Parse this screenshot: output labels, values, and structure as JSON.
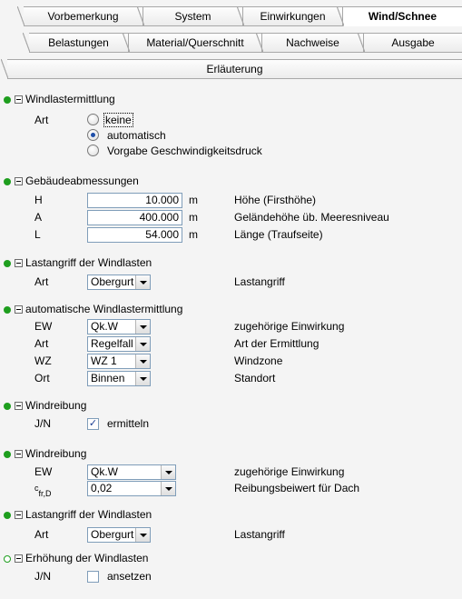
{
  "tabs": {
    "row1": [
      "Vorbemerkung",
      "System",
      "Einwirkungen",
      "Wind/Schnee"
    ],
    "row1_active_index": 3,
    "row2": [
      "Belastungen",
      "Material/Querschnitt",
      "Nachweise",
      "Ausgabe"
    ],
    "row3": [
      "Erläuterung"
    ]
  },
  "colors": {
    "status_green": "#1e9e1e",
    "field_border": "#7f9db9",
    "radio_selected": "#1f4fa8"
  },
  "sections": {
    "windlastermittlung": {
      "title": "Windlastermittlung",
      "art_label": "Art",
      "options": [
        "keine",
        "automatisch",
        "Vorgabe Geschwindigkeitsdruck"
      ],
      "selected": "automatisch"
    },
    "gebaeude": {
      "title": "Gebäudeabmessungen",
      "rows": [
        {
          "label": "H",
          "value": "10.000",
          "unit": "m",
          "desc": "Höhe (Firsthöhe)"
        },
        {
          "label": "A",
          "value": "400.000",
          "unit": "m",
          "desc": "Geländehöhe üb. Meeresniveau"
        },
        {
          "label": "L",
          "value": "54.000",
          "unit": "m",
          "desc": "Länge (Traufseite)"
        }
      ]
    },
    "lastangriff1": {
      "title": "Lastangriff der Windlasten",
      "label": "Art",
      "value": "Obergurt",
      "desc": "Lastangriff"
    },
    "auto": {
      "title": "automatische Windlastermittlung",
      "rows": [
        {
          "label": "EW",
          "value": "Qk.W",
          "desc": "zugehörige Einwirkung"
        },
        {
          "label": "Art",
          "value": "Regelfall",
          "desc": "Art der Ermittlung"
        },
        {
          "label": "WZ",
          "value": "WZ 1",
          "desc": "Windzone"
        },
        {
          "label": "Ort",
          "value": "Binnen",
          "desc": "Standort"
        }
      ]
    },
    "windreibung1": {
      "title": "Windreibung",
      "label": "J/N",
      "checkbox_label": "ermitteln",
      "checked": true
    },
    "windreibung2": {
      "title": "Windreibung",
      "rows": [
        {
          "label": "EW",
          "value": "Qk.W",
          "desc": "zugehörige Einwirkung"
        },
        {
          "label_main": "c",
          "label_sub": "fr,D",
          "value": "0,02",
          "desc": "Reibungsbeiwert für Dach"
        }
      ]
    },
    "lastangriff2": {
      "title": "Lastangriff der Windlasten",
      "label": "Art",
      "value": "Obergurt",
      "desc": "Lastangriff"
    },
    "erhoehung": {
      "title": "Erhöhung der Windlasten",
      "label": "J/N",
      "checkbox_label": "ansetzen",
      "checked": false
    }
  }
}
